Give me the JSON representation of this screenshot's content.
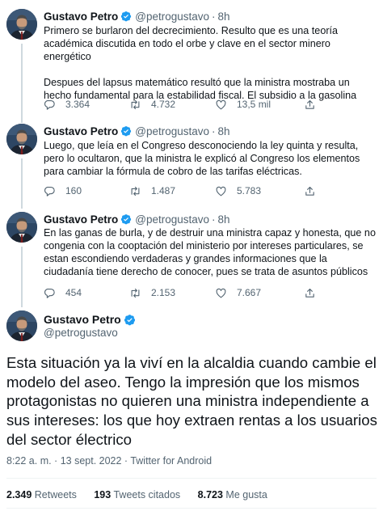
{
  "author": {
    "name": "Gustavo Petro",
    "handle": "@petrogustavo"
  },
  "colors": {
    "verified": "#1d9bf0",
    "text": "#0f1419",
    "muted": "#536471"
  },
  "thread": [
    {
      "time": "8h",
      "paragraphs": [
        "Primero se burlaron del decrecimiento. Resulto que es una teoría académica discutida en todo el orbe y clave en el sector minero energético",
        "Despues del lapsus matemático resultó que la ministra mostraba un hecho fundamental para la estabilidad fiscal. El subsidio a la gasolina"
      ],
      "replies": "3.364",
      "retweets": "4.732",
      "likes": "13,5 mil"
    },
    {
      "time": "8h",
      "paragraphs": [
        "Luego, que leía en el Congreso desconociendo la ley quinta y resulta, pero lo ocultaron, que la ministra le explicó al Congreso los elementos para cambiar la fórmula de cobro de las tarifas eléctricas."
      ],
      "replies": "160",
      "retweets": "1.487",
      "likes": "5.783"
    },
    {
      "time": "8h",
      "paragraphs": [
        "En las ganas de burla, y de destruir una ministra capaz y honesta, que no congenia con la cooptación del ministerio por  intereses particulares, se estan escondiendo verdaderas y grandes informaciones que la ciudadanía tiene derecho de conocer, pues se trata de asuntos públicos"
      ],
      "replies": "454",
      "retweets": "2.153",
      "likes": "7.667"
    }
  ],
  "main": {
    "text": "Esta situación ya la viví en la alcaldia cuando cambie el modelo del aseo. Tengo la impresión que los mismos protagonistas no quieren una ministra independiente a sus intereses: los que hoy extraen rentas a los usuarios del sector électrico",
    "meta": "8:22 a. m. · 13 sept. 2022 · Twitter for Android",
    "retweets_count": "2.349",
    "retweets_label": "Retweets",
    "quotes_count": "193",
    "quotes_label": "Tweets citados",
    "likes_count": "8.723",
    "likes_label": "Me gusta"
  }
}
